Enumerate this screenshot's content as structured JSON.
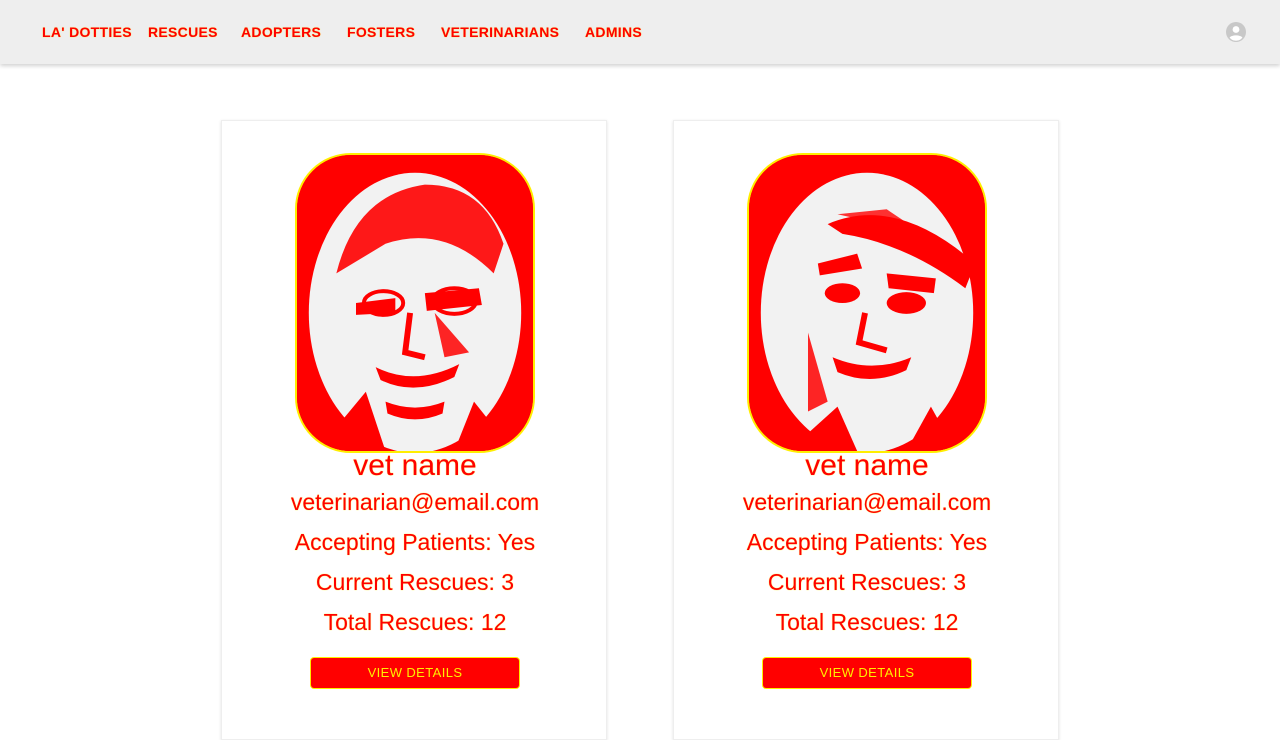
{
  "nav": {
    "brand": "LA' DOTTIES",
    "links": [
      "RESCUES",
      "ADOPTERS",
      "FOSTERS",
      "VETERINARIANS",
      "ADMINS"
    ]
  },
  "cards": [
    {
      "name": "vet name",
      "email": "veterinarian@email.com",
      "accepting": "Accepting Patients: Yes",
      "current": "Current Rescues: 3",
      "total": "Total Rescues: 12",
      "button": "VIEW DETAILS"
    },
    {
      "name": "vet name",
      "email": "veterinarian@email.com",
      "accepting": "Accepting Patients: Yes",
      "current": "Current Rescues: 3",
      "total": "Total Rescues: 12",
      "button": "VIEW DETAILS"
    }
  ],
  "colors": {
    "accent": "#ff0000",
    "highlight": "#ffee00",
    "navbar": "#eeeeee"
  },
  "icons": {
    "account": "account-circle-icon"
  }
}
